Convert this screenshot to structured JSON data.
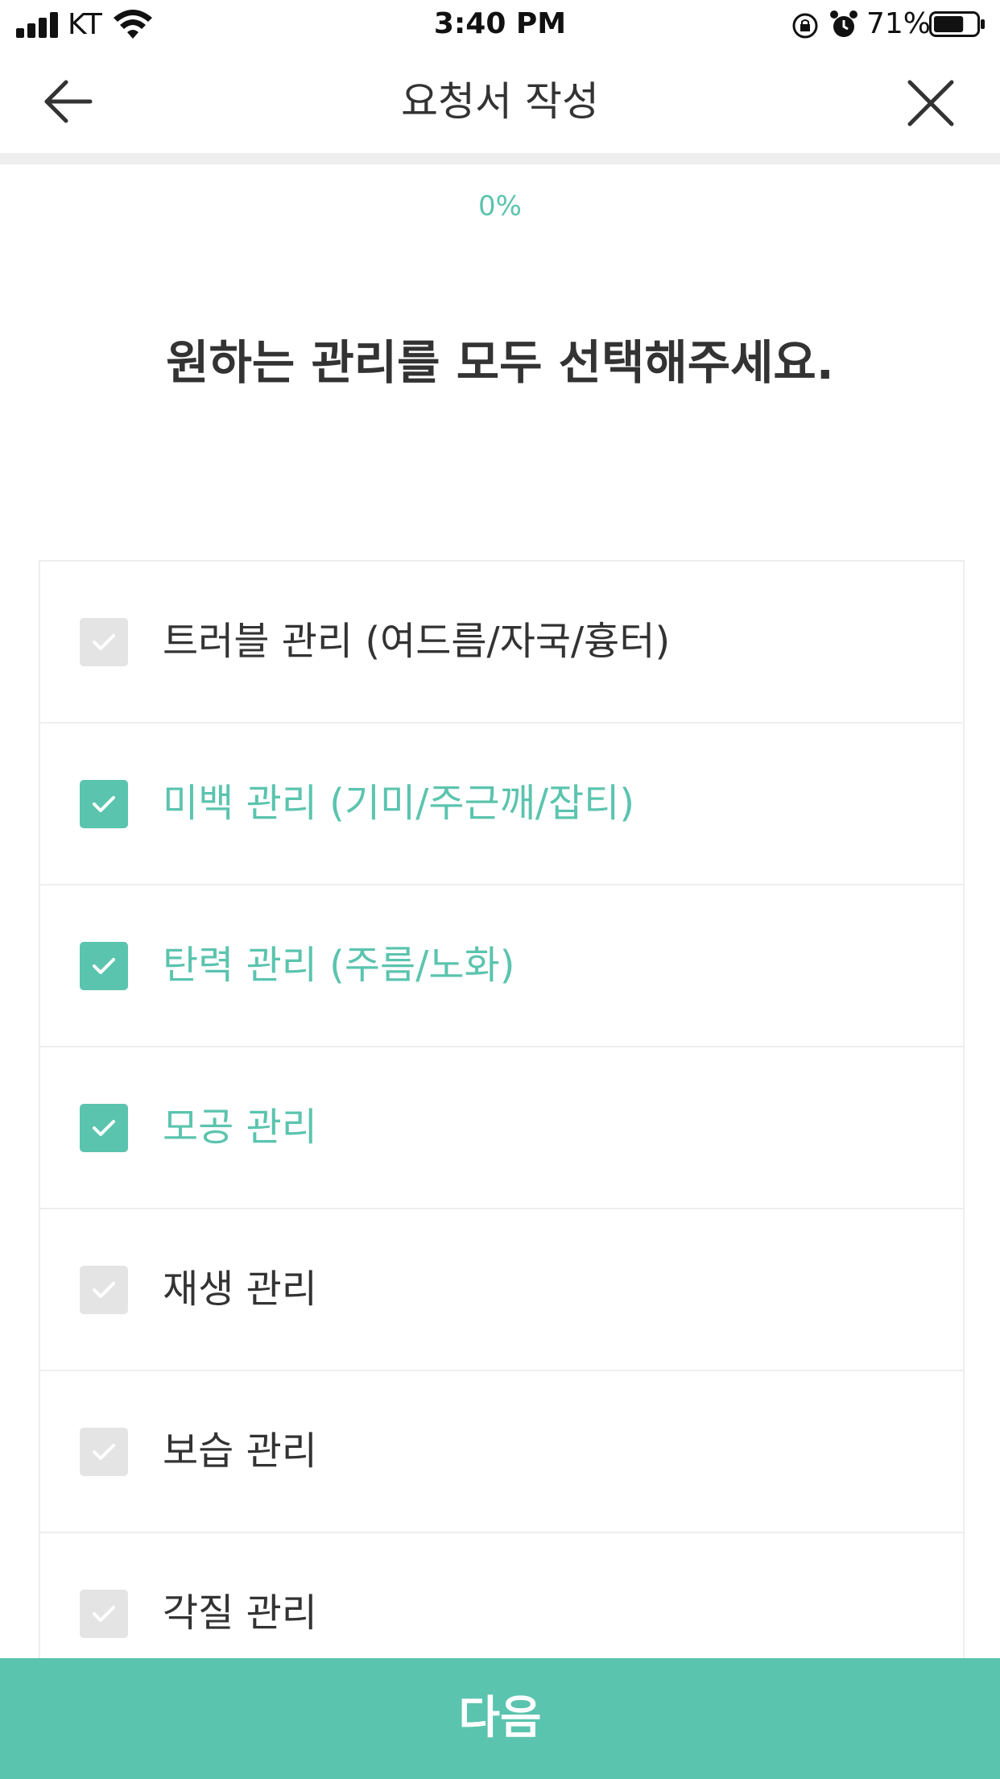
{
  "status_bar": {
    "carrier": "KT",
    "time": "3:40 PM",
    "battery_percent": "71%",
    "battery_level": 0.71,
    "icons": [
      "signal-icon",
      "wifi-icon",
      "rotation-lock-icon",
      "alarm-icon",
      "battery-icon"
    ]
  },
  "header": {
    "title": "요청서 작성",
    "back_icon": "arrow-left-icon",
    "close_icon": "close-icon"
  },
  "progress": {
    "label": "0%",
    "value": 0
  },
  "question": "원하는 관리를 모두 선택해주세요.",
  "options": [
    {
      "label": "트러블 관리 (여드름/자국/흉터)",
      "checked": false
    },
    {
      "label": "미백 관리 (기미/주근깨/잡티)",
      "checked": true
    },
    {
      "label": "탄력 관리 (주름/노화)",
      "checked": true
    },
    {
      "label": "모공 관리",
      "checked": true
    },
    {
      "label": "재생 관리",
      "checked": false
    },
    {
      "label": "보습 관리",
      "checked": false
    },
    {
      "label": "각질 관리",
      "checked": false
    }
  ],
  "next_button": "다음",
  "colors": {
    "accent": "#5bc4ae",
    "unchecked_box": "#e4e4e4",
    "text": "#333333"
  }
}
